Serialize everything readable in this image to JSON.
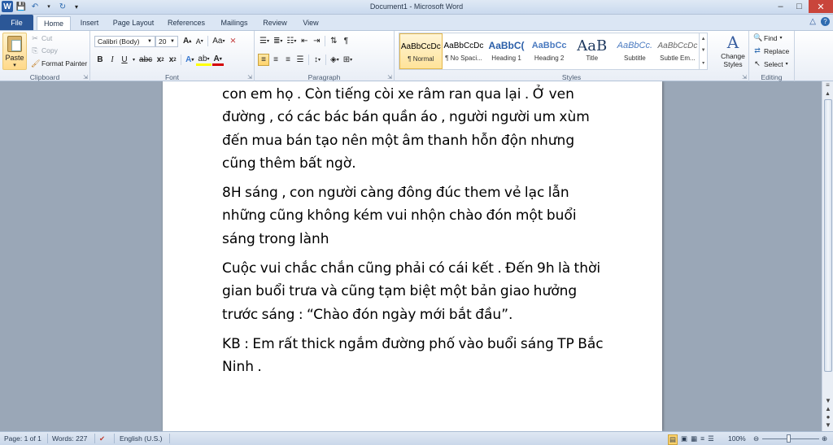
{
  "window": {
    "title": "Document1 - Microsoft Word",
    "app_icon": "W"
  },
  "tabs": {
    "file": "File",
    "items": [
      "Home",
      "Insert",
      "Page Layout",
      "References",
      "Mailings",
      "Review",
      "View"
    ],
    "active": "Home"
  },
  "clipboard": {
    "paste": "Paste",
    "cut": "Cut",
    "copy": "Copy",
    "format_painter": "Format Painter",
    "label": "Clipboard"
  },
  "font": {
    "name": "Calibri (Body)",
    "size": "20",
    "label": "Font"
  },
  "paragraph": {
    "label": "Paragraph"
  },
  "styles": {
    "label": "Styles",
    "items": [
      {
        "sample": "AaBbCcDc",
        "name": "¶ Normal"
      },
      {
        "sample": "AaBbCcDc",
        "name": "¶ No Spaci..."
      },
      {
        "sample": "AaBbC(",
        "name": "Heading 1"
      },
      {
        "sample": "AaBbCc",
        "name": "Heading 2"
      },
      {
        "sample": "AaB",
        "name": "Title"
      },
      {
        "sample": "AaBbCc.",
        "name": "Subtitle"
      },
      {
        "sample": "AaBbCcDc",
        "name": "Subtle Em..."
      }
    ],
    "selected": "¶ Normal",
    "change_styles": "Change Styles"
  },
  "editing": {
    "find": "Find",
    "replace": "Replace",
    "select": "Select",
    "label": "Editing"
  },
  "document": {
    "paragraphs": [
      "con em họ . Còn tiếng còi xe râm ran qua lại . Ở ven đường , có các bác bán quần áo , người người um xùm đến mua bán tạo nên một âm thanh hỗn độn nhưng cũng thêm bất ngờ.",
      "8H sáng , con người càng đông đúc them vẻ lạc lẫn những cũng không kém vui nhộn chào đón một buổi sáng trong lành",
      "Cuộc vui chắc chắn cũng phải có cái kết . Đến 9h là thời gian buổi trưa và cũng tạm biệt một bản giao hưởng trước sáng : “Chào đón ngày mới bắt đầu”.",
      "KB : Em rất thick ngắm đường phố vào buổi sáng TP Bắc Ninh ."
    ]
  },
  "status": {
    "page": "Page: 1 of 1",
    "words": "Words: 227",
    "language": "English (U.S.)",
    "zoom": "100%"
  }
}
